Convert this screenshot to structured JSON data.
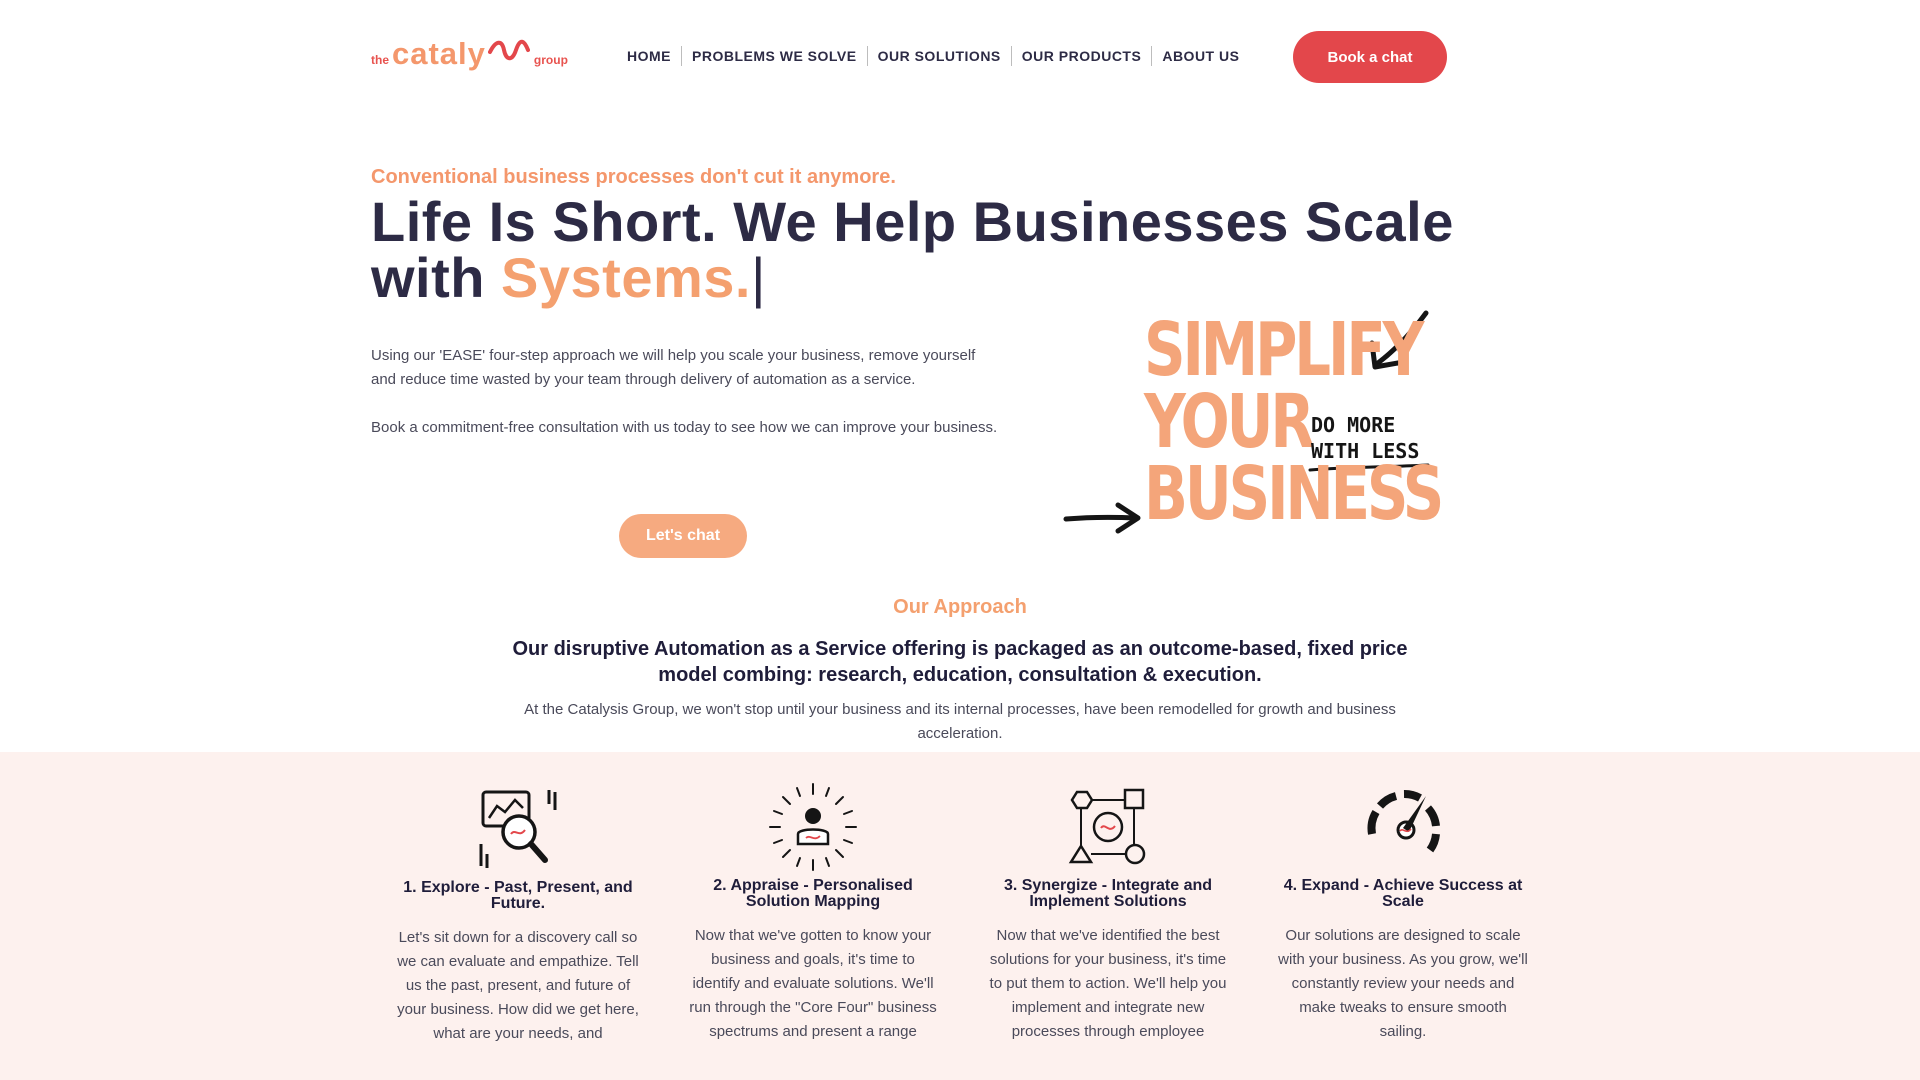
{
  "header": {
    "logo": {
      "the": "the",
      "name": "cataly",
      "group": "group"
    },
    "nav": [
      "HOME",
      "PROBLEMS WE SOLVE",
      "OUR SOLUTIONS",
      "OUR PRODUCTS",
      "ABOUT US"
    ],
    "cta": "Book a chat"
  },
  "hero": {
    "eyebrow": "Conventional business processes don't cut it anymore.",
    "headline_line1": "Life Is Short. We Help Businesses Scale",
    "headline_with": "with ",
    "headline_accent": "Systems.",
    "headline_cursor": "|",
    "paragraph1": "Using our 'EASE' four-step approach we will help you scale your business, remove yourself and reduce time wasted by your team through delivery of automation as a service.",
    "paragraph2": "Book a commitment-free consultation with us today to see how we can improve your business.",
    "button": "Let's chat",
    "graphic": {
      "line1": "SIMPLIFY",
      "line2": "YOUR",
      "line3": "BUSINESS",
      "hand1": "DO MORE",
      "hand2": "WITH LESS"
    }
  },
  "approach": {
    "kicker": "Our Approach",
    "title": "Our disruptive Automation as a Service offering is packaged as an outcome-based, fixed price model combing: research, education, consultation & execution.",
    "text": "At the Catalysis Group, we won't stop until your business and its internal processes, have been remodelled for growth and business acceleration."
  },
  "steps": [
    {
      "title": "1. Explore - Past, Present, and Future.",
      "text": "Let's sit down for a discovery call so we can evaluate and empathize. Tell us the past, present, and future of your business. How did we get here, what are your needs, and",
      "icon": "magnifier-chart-icon"
    },
    {
      "title": "2. Appraise - Personalised Solution Mapping",
      "text": "Now that we've gotten to know your business and goals, it's time to identify and evaluate solutions. We'll run through the \"Core Four\" business spectrums and present a range",
      "icon": "person-burst-icon"
    },
    {
      "title": "3. Synergize - Integrate and Implement Solutions",
      "text": "Now that we've identified the best solutions for your business, it's time to put them to action. We'll help you implement and integrate new processes through employee",
      "icon": "process-flow-icon"
    },
    {
      "title": "4. Expand - Achieve Success at Scale",
      "text": "Our solutions are designed to scale with your business. As you grow, we'll constantly review your needs and make tweaks to ensure smooth sailing.",
      "icon": "speedometer-icon"
    }
  ],
  "colors": {
    "accent_red": "#e3474b",
    "accent_peach": "#f4a06f",
    "navy": "#2d2b45",
    "band": "#fdf1ee"
  }
}
